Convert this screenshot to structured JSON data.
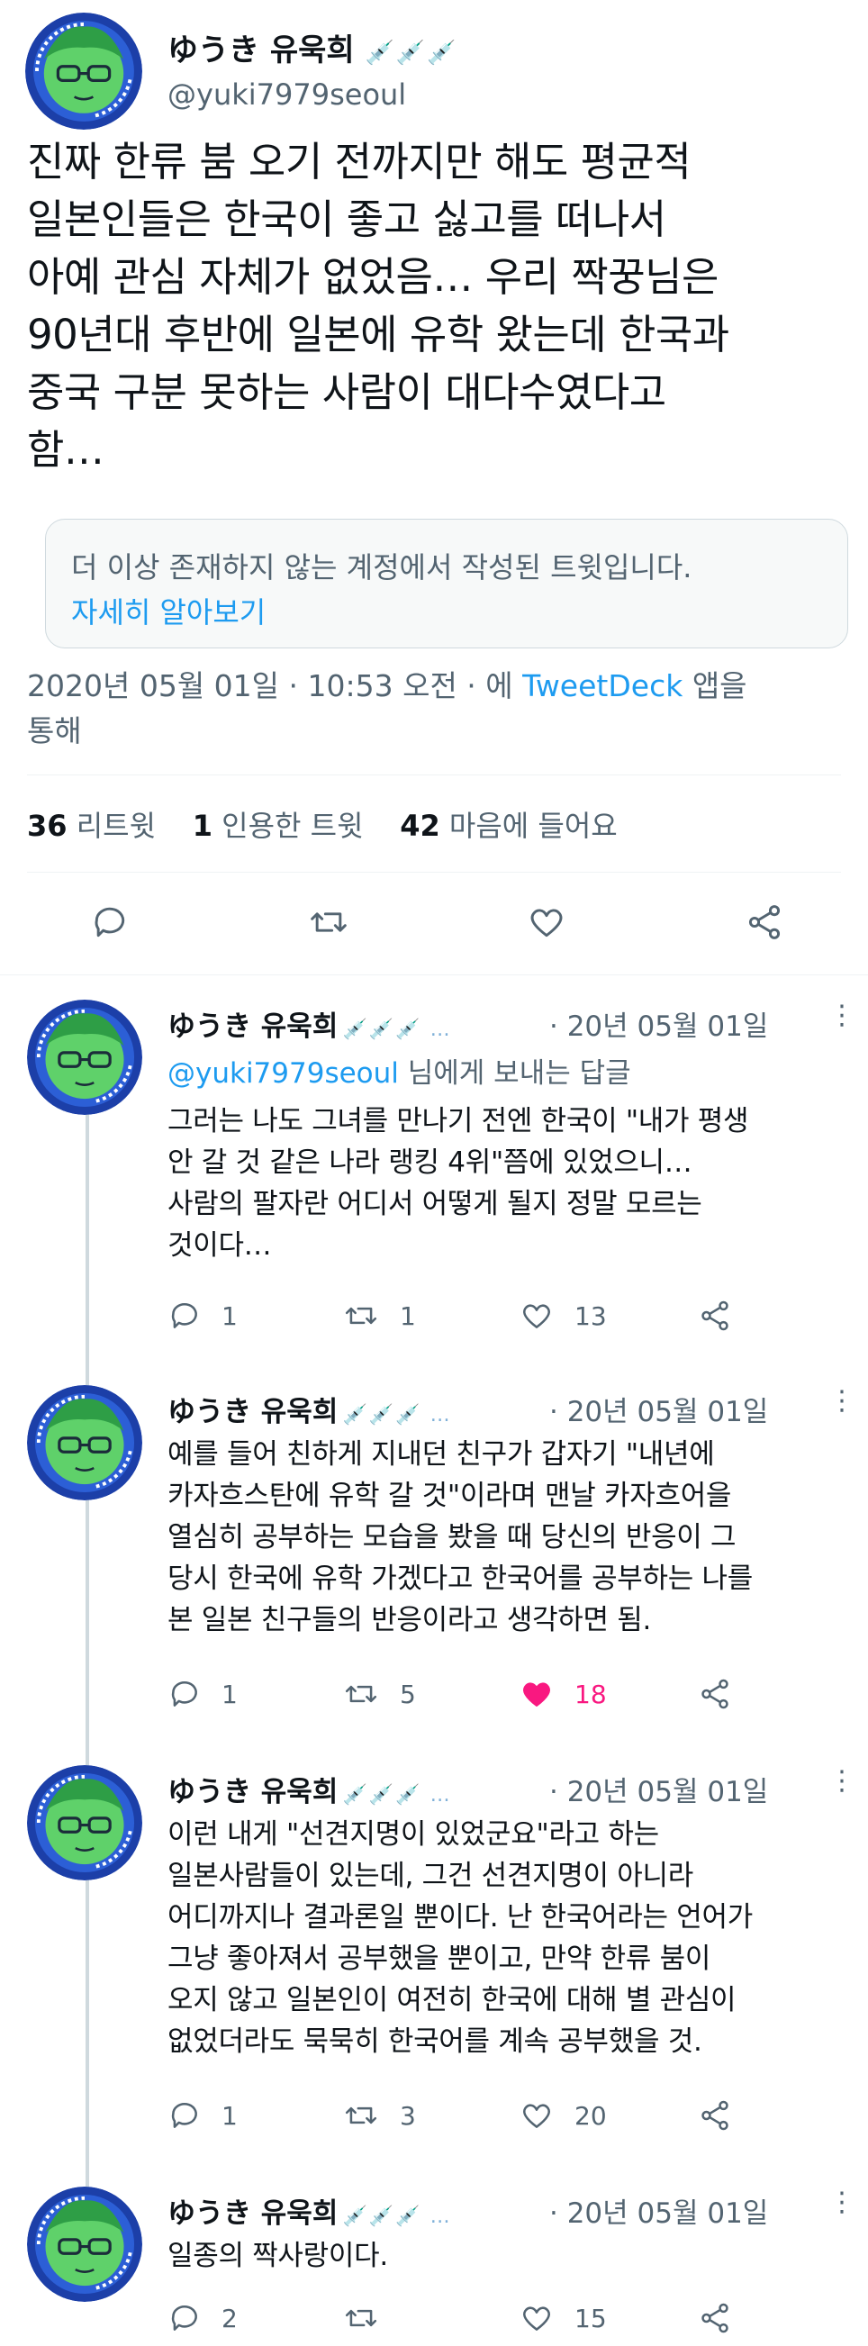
{
  "main": {
    "name": "ゆうき 유욱희",
    "syringes": "💉💉💉",
    "handle": "@yuki7979seoul",
    "text": "진짜 한류 붐 오기 전까지만 해도 평균적\n일본인들은 한국이 좋고 싫고를 떠나서\n아예 관심 자체가 없었음… 우리 짝꿍님은\n90년대 후반에 일본에 유학 왔는데 한국과\n중국 구분 못하는 사람이 대다수였다고\n함…",
    "notice_text": "더 이상 존재하지 않는 계정에서 작성된 트윗입니다.",
    "notice_link": "자세히 알아보기",
    "meta_pre": "2020년 05월 01일 · 10:53 오전 · 에 ",
    "meta_link": "TweetDeck",
    "meta_post": " 앱을",
    "meta_line2": "통해",
    "retweets_count": "36",
    "retweets_label": "리트윗",
    "quotes_count": "1",
    "quotes_label": "인용한 트윗",
    "likes_count": "42",
    "likes_label": "마음에 들어요"
  },
  "replies": [
    {
      "name": "ゆうき 유욱희",
      "syringes": "💉💉💉 …",
      "time": "· 20년 05월 01일",
      "replying_handle": "@yuki7979seoul",
      "replying_suffix": " 님에게 보내는 답글",
      "text": "그러는 나도 그녀를 만나기 전엔 한국이 \"내가 평생\n안 갈 것 같은 나라 랭킹 4위\"쯤에 있었으니…\n사람의 팔자란 어디서 어떻게 될지 정말 모르는\n것이다…",
      "replies": "1",
      "retweets": "1",
      "likes": "13",
      "liked": false
    },
    {
      "name": "ゆうき 유욱희",
      "syringes": "💉💉💉 …",
      "time": "· 20년 05월 01일",
      "text": "예를 들어 친하게 지내던 친구가 갑자기 \"내년에\n카자흐스탄에 유학 갈 것\"이라며 맨날 카자흐어을\n열심히 공부하는 모습을 봤을 때 당신의 반응이 그\n당시 한국에 유학 가겠다고 한국어를 공부하는 나를\n본 일본 친구들의 반응이라고 생각하면 됨.",
      "replies": "1",
      "retweets": "5",
      "likes": "18",
      "liked": true
    },
    {
      "name": "ゆうき 유욱희",
      "syringes": "💉💉💉 …",
      "time": "· 20년 05월 01일",
      "text": "이런 내게 \"선견지명이 있었군요\"라고 하는\n일본사람들이 있는데, 그건 선견지명이 아니라\n어디까지나 결과론일 뿐이다. 난 한국어라는 언어가\n그냥 좋아져서 공부했을 뿐이고, 만약 한류 붐이\n오지 않고 일본인이 여전히 한국에 대해 별 관심이\n없었더라도 묵묵히 한국어를 계속 공부했을 것.",
      "replies": "1",
      "retweets": "3",
      "likes": "20",
      "liked": false
    },
    {
      "name": "ゆうき 유욱희",
      "syringes": "💉💉💉 …",
      "time": "· 20년 05월 01일",
      "text": "일종의 짝사랑이다.",
      "replies": "2",
      "retweets": "",
      "likes": "15",
      "liked": false
    }
  ],
  "colors": {
    "accent": "#1d9bf0",
    "like": "#f91880",
    "muted": "#536471"
  }
}
